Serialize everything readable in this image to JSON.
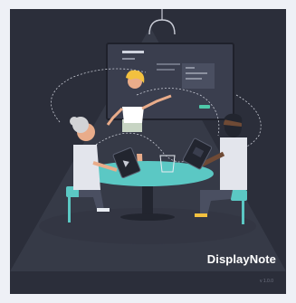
{
  "app": {
    "name": "DisplayNote",
    "version": "v 1.0.0"
  },
  "illustration": {
    "subject": "presenter-at-screen-with-team-around-table",
    "icons": [
      "ceiling-lamp-icon",
      "screen-icon",
      "tablet-icon",
      "glass-icon"
    ]
  },
  "colors": {
    "background": "#2b2e3a",
    "page": "#eef0f6",
    "table": "#5bc8c4",
    "screen": "#3a3e4e",
    "accent_green": "#4fc8a9",
    "hair_blonde": "#f3c13f",
    "brand_text": "#ffffff",
    "version_text": "#6f7382"
  }
}
